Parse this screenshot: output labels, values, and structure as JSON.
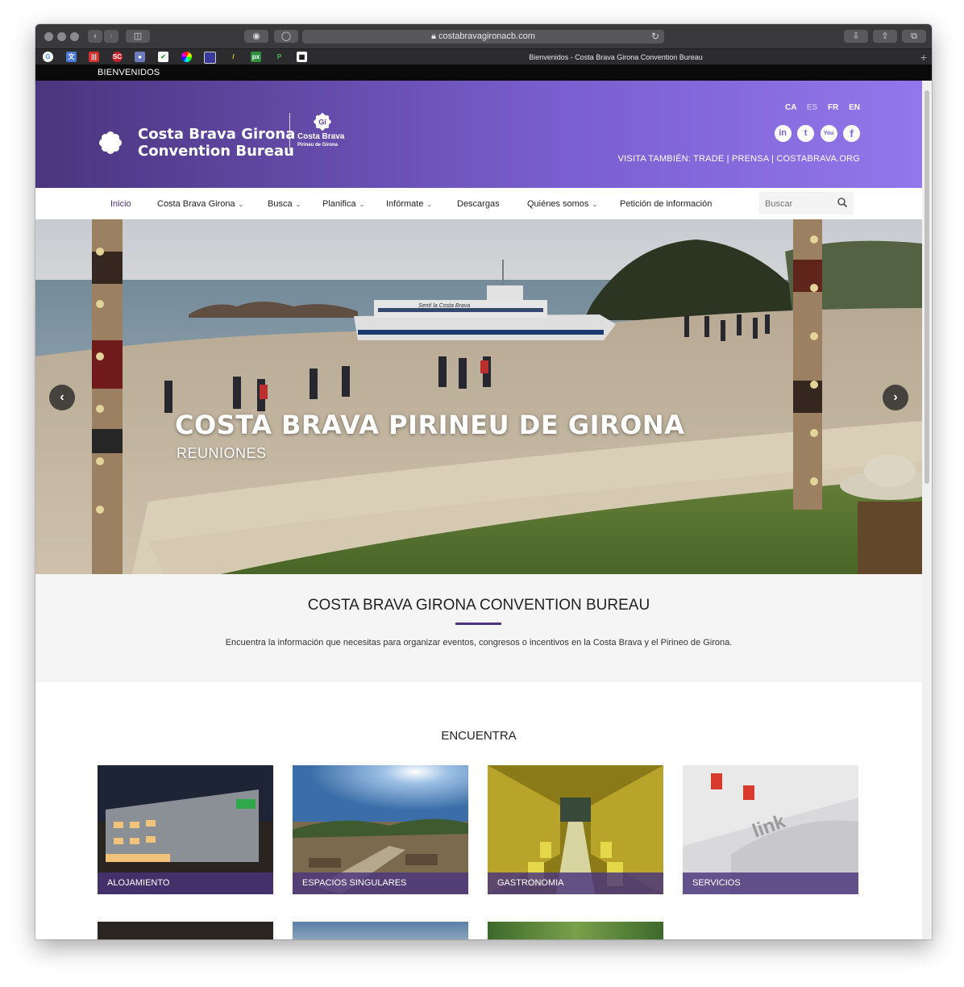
{
  "browser": {
    "url": "costabravagironacb.com",
    "tab_title": "Bienvenidos - Costa Brava Girona Convention Bureau",
    "tab_plus": "+"
  },
  "topbar": {
    "label": "BIENVENIDOS"
  },
  "header": {
    "logo_line1": "Costa Brava Girona",
    "logo_line2": "Convention Bureau",
    "gi_badge": "Gi",
    "gi_brand": "Costa Brava",
    "gi_sub": "Pirineu de Girona",
    "languages": [
      "CA",
      "ES",
      "FR",
      "EN"
    ],
    "active_language": "ES",
    "socials": [
      {
        "icon": "linkedin-icon",
        "glyph": "in"
      },
      {
        "icon": "twitter-icon",
        "glyph": "t"
      },
      {
        "icon": "youtube-icon",
        "glyph": "You"
      },
      {
        "icon": "facebook-icon",
        "glyph": "f"
      }
    ],
    "visit_text": "VISITA TAMBIÉN: TRADE | PRENSA | COSTABRAVA.ORG"
  },
  "nav": {
    "items": [
      {
        "label": "Inicio",
        "dropdown": false
      },
      {
        "label": "Costa Brava Girona",
        "dropdown": true
      },
      {
        "label": "Busca",
        "dropdown": true
      },
      {
        "label": "Planifica",
        "dropdown": true
      },
      {
        "label": "Infórmate",
        "dropdown": true
      },
      {
        "label": "Descargas",
        "dropdown": false
      },
      {
        "label": "Quiénes somos",
        "dropdown": true
      },
      {
        "label": "Petición de información",
        "dropdown": false
      }
    ],
    "search_placeholder": "Buscar"
  },
  "hero": {
    "title": "COSTA BRAVA PIRINEU DE GIRONA",
    "subtitle": "REUNIONES",
    "boat_name": "Sentí la Costa Brava"
  },
  "intro": {
    "title": "COSTA BRAVA GIRONA CONVENTION BUREAU",
    "text": "Encuentra la información que necesitas para organizar eventos, congresos o incentivos en la Costa Brava y el Pirineo de Girona."
  },
  "find": {
    "title": "ENCUENTRA",
    "cards": [
      {
        "label": "ALOJAMIENTO"
      },
      {
        "label": "ESPACIOS SINGULARES"
      },
      {
        "label": "GASTRONOMIA"
      },
      {
        "label": "SERVICIOS"
      }
    ]
  },
  "colors": {
    "brand_purple": "#4b357e",
    "header_gradient_end": "#9277ec"
  }
}
